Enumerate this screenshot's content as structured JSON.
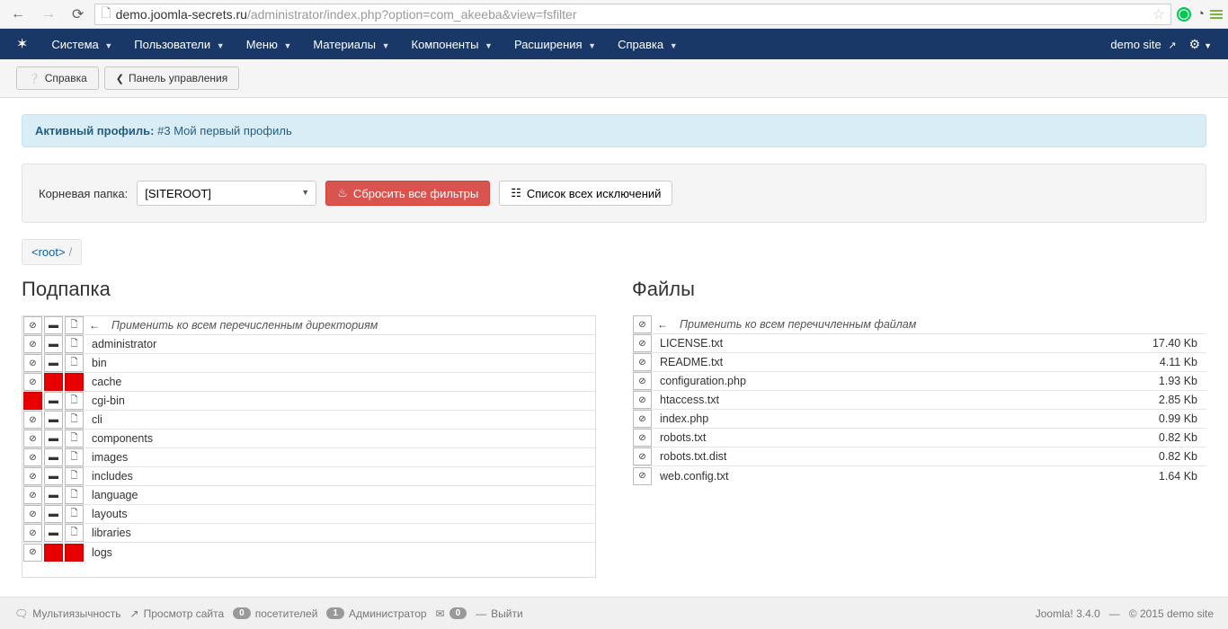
{
  "browser": {
    "url_host": "demo.joomla-secrets.ru",
    "url_path": "/administrator/index.php?option=com_akeeba&view=fsfilter"
  },
  "nav": {
    "items": [
      "Система",
      "Пользователи",
      "Меню",
      "Материалы",
      "Компоненты",
      "Расширения",
      "Справка"
    ],
    "site_label": "demo site"
  },
  "toolbar": {
    "help_label": "Справка",
    "cpanel_label": "Панель управления"
  },
  "profile": {
    "active_label": "Активный профиль:",
    "num": "#3",
    "name": "Мой первый профиль"
  },
  "well": {
    "root_label": "Корневая папка:",
    "root_value": "[SITEROOT]",
    "reset_label": "Сбросить все фильтры",
    "list_label": "Список всех исключений"
  },
  "breadcrumb": {
    "root": "<root>"
  },
  "cols": {
    "folders_title": "Подпапка",
    "files_title": "Файлы",
    "folders_header": "Применить ко всем перечисленным директориям",
    "files_header": "Применить ко всем перечичленным файлам"
  },
  "folders": [
    {
      "name": "administrator",
      "f": [
        0,
        0,
        0
      ]
    },
    {
      "name": "bin",
      "f": [
        0,
        0,
        0
      ]
    },
    {
      "name": "cache",
      "f": [
        0,
        1,
        1
      ]
    },
    {
      "name": "cgi-bin",
      "f": [
        1,
        0,
        0
      ]
    },
    {
      "name": "cli",
      "f": [
        0,
        0,
        0
      ]
    },
    {
      "name": "components",
      "f": [
        0,
        0,
        0
      ]
    },
    {
      "name": "images",
      "f": [
        0,
        0,
        0
      ]
    },
    {
      "name": "includes",
      "f": [
        0,
        0,
        0
      ]
    },
    {
      "name": "language",
      "f": [
        0,
        0,
        0
      ]
    },
    {
      "name": "layouts",
      "f": [
        0,
        0,
        0
      ]
    },
    {
      "name": "libraries",
      "f": [
        0,
        0,
        0
      ]
    },
    {
      "name": "logs",
      "f": [
        0,
        1,
        1
      ]
    }
  ],
  "files": [
    {
      "name": "LICENSE.txt",
      "size": "17.40 Kb"
    },
    {
      "name": "README.txt",
      "size": "4.11 Kb"
    },
    {
      "name": "configuration.php",
      "size": "1.93 Kb"
    },
    {
      "name": "htaccess.txt",
      "size": "2.85 Kb"
    },
    {
      "name": "index.php",
      "size": "0.99 Kb"
    },
    {
      "name": "robots.txt",
      "size": "0.82 Kb"
    },
    {
      "name": "robots.txt.dist",
      "size": "0.82 Kb"
    },
    {
      "name": "web.config.txt",
      "size": "1.64 Kb"
    }
  ],
  "status": {
    "multi": "Мультиязычность",
    "preview": "Просмотр сайта",
    "visitors_count": "0",
    "visitors": "посетителей",
    "admins_count": "1",
    "admins": "Администратор",
    "messages_count": "0",
    "logout": "Выйти",
    "version": "Joomla! 3.4.0",
    "dash": "—",
    "copyright": "© 2015 demo site"
  },
  "icons": {
    "cancel": "⊘",
    "folder": "📁",
    "file": "🗋",
    "list": "☰",
    "fire": "⚙",
    "help": "❔",
    "cog": "⚙",
    "back_arrow": "←"
  }
}
